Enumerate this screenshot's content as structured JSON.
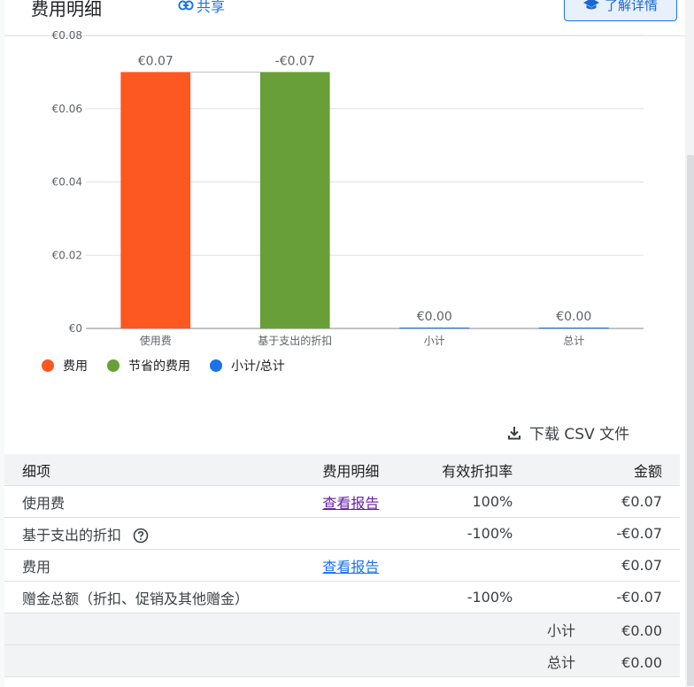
{
  "header": {
    "title": "费用明细",
    "share_label": "共享",
    "learn_more_label": "了解详情"
  },
  "chart_data": {
    "type": "bar",
    "categories": [
      "使用费",
      "基于支出的折扣",
      "小计",
      "总计"
    ],
    "values": [
      0.07,
      -0.07,
      0.0,
      0.0
    ],
    "bar_heights": [
      0.07,
      0.07,
      0.0,
      0.0
    ],
    "data_labels": [
      "€0.07",
      "-€0.07",
      "€0.00",
      "€0.00"
    ],
    "colors": [
      "#fd5722",
      "#689f38",
      "#1a73e8",
      "#1a73e8"
    ],
    "ylim": [
      0,
      0.08
    ],
    "yticks": [
      0,
      0.02,
      0.04,
      0.06,
      0.08
    ],
    "ytick_labels": [
      "€0",
      "€0.02",
      "€0.04",
      "€0.06",
      "€0.08"
    ],
    "grid": true,
    "legend_position": "bottom-left",
    "legend": [
      {
        "label": "费用",
        "color": "#fd5722"
      },
      {
        "label": "节省的费用",
        "color": "#689f38"
      },
      {
        "label": "小计/总计",
        "color": "#1a73e8"
      }
    ]
  },
  "download": {
    "label": "下载 CSV 文件"
  },
  "table": {
    "headers": [
      "细项",
      "费用明细",
      "有效折扣率",
      "金额"
    ],
    "rows": [
      {
        "item": "使用费",
        "detail": "查看报告",
        "rate": "100%",
        "amount": "€0.07"
      },
      {
        "item": "基于支出的折扣",
        "detail": "",
        "rate": "-100%",
        "amount": "-€0.07"
      },
      {
        "item": "费用",
        "detail": "查看报告",
        "rate": "",
        "amount": "€0.07"
      },
      {
        "item": "赠金总额（折扣、促销及其他赠金）",
        "detail": "",
        "rate": "-100%",
        "amount": "-€0.07"
      }
    ],
    "subtotal_label": "小计",
    "subtotal_value": "€0.00",
    "total_label": "总计",
    "total_value": "€0.00"
  }
}
